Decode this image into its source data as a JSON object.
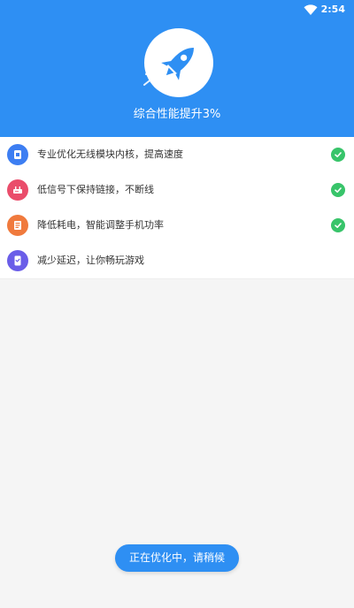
{
  "status_bar": {
    "time": "2:54",
    "icons": [
      "wifi-icon"
    ]
  },
  "header": {
    "background": "#2e8ff3",
    "icon": "rocket-icon",
    "title": "综合性能提升3%"
  },
  "items": [
    {
      "icon": "chip-icon",
      "icon_color": "#3d7ef2",
      "label": "专业优化无线模块内核，提高速度",
      "completed": true
    },
    {
      "icon": "router-icon",
      "icon_color": "#ea4d6b",
      "label": "低信号下保持链接，不断线",
      "completed": true
    },
    {
      "icon": "battery-doc-icon",
      "icon_color": "#f07a3d",
      "label": "降低耗电，智能调整手机功率",
      "completed": true
    },
    {
      "icon": "game-phone-icon",
      "icon_color": "#6a5de8",
      "label": "减少延迟，让你畅玩游戏",
      "completed": false
    }
  ],
  "check_color": "#38c46a",
  "action_button": {
    "label": "正在优化中，请稍候",
    "color": "#2e8ff3"
  }
}
